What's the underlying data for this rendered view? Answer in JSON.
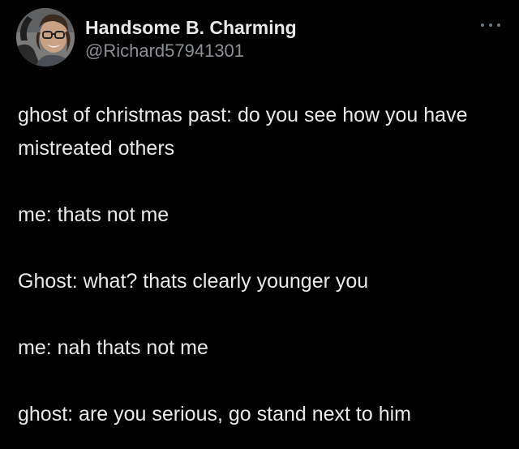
{
  "author": {
    "display_name": "Handsome B. Charming",
    "handle": "@Richard57941301",
    "avatar_icon": "profile-photo-avatar"
  },
  "actions": {
    "more_icon": "more-horizontal-icon"
  },
  "tweet": {
    "paragraphs": [
      "ghost of christmas past: do you see how you have mistreated others",
      "me: thats not me",
      "Ghost: what? thats clearly younger you",
      "me: nah thats not me",
      "ghost: are you serious, go stand next to him"
    ]
  },
  "colors": {
    "background": "#000000",
    "text": "#e7e9ea",
    "secondary": "#8b8f94"
  }
}
